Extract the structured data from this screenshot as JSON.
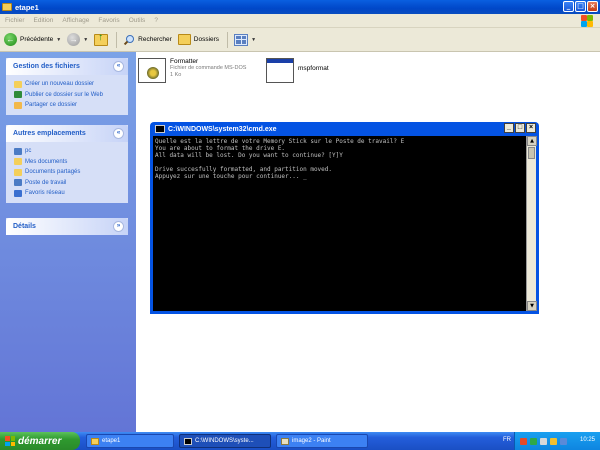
{
  "window": {
    "title": "etape1"
  },
  "menu": [
    "Fichier",
    "Edition",
    "Affichage",
    "Favoris",
    "Outils",
    "?"
  ],
  "toolbar": {
    "back_label": "Précédente",
    "search_label": "Rechercher",
    "folders_label": "Dossiers"
  },
  "panels": [
    {
      "title": "Gestion des fichiers",
      "chevron": "«",
      "items": [
        {
          "label": "Créer un nouveau dossier",
          "icon": "new-folder-icon",
          "color": "#f4cf5a"
        },
        {
          "label": "Publier ce dossier sur le Web",
          "icon": "globe-icon",
          "color": "#2f8a3a"
        },
        {
          "label": "Partager ce dossier",
          "icon": "share-icon",
          "color": "#f2b84b"
        }
      ]
    },
    {
      "title": "Autres emplacements",
      "chevron": "«",
      "items": [
        {
          "label": "pc",
          "icon": "computer-icon",
          "color": "#4b7bc4"
        },
        {
          "label": "Mes documents",
          "icon": "documents-folder-icon",
          "color": "#f4cf5a"
        },
        {
          "label": "Documents partagés",
          "icon": "shared-folder-icon",
          "color": "#f4cf5a"
        },
        {
          "label": "Poste de travail",
          "icon": "workstation-icon",
          "color": "#4b7bc4"
        },
        {
          "label": "Favoris réseau",
          "icon": "network-icon",
          "color": "#3a6fd0"
        }
      ]
    },
    {
      "title": "Détails",
      "chevron": "»",
      "items": []
    }
  ],
  "files": [
    {
      "name": "Formatter",
      "type": "Fichier de commande MS-DOS",
      "size": "1 Ko",
      "icon": "batch-file-icon"
    },
    {
      "name": "mspformat",
      "type": "",
      "size": "",
      "icon": "app-window-icon"
    }
  ],
  "console": {
    "title": "C:\\WINDOWS\\system32\\cmd.exe",
    "lines": [
      "Quelle est la lettre de votre Memory Stick sur le Poste de travail? E",
      "You are about to format the drive E.",
      "All data will be lost. Do you want to continue? [Y]Y",
      "",
      "Drive succesfully formatted, and partition moved.",
      "Appuyez sur une touche pour continuer... _"
    ]
  },
  "taskbar": {
    "start_label": "démarrer",
    "tasks": [
      {
        "label": "etape1",
        "active": false
      },
      {
        "label": "C:\\WINDOWS\\syste...",
        "active": true
      },
      {
        "label": "image2 - Paint",
        "active": false
      }
    ],
    "lang": "FR",
    "clock": "10:25"
  },
  "colors": {
    "title_blue": "#0453e3",
    "task_link": "#215dc6",
    "start_green": "#2f9a2f"
  }
}
